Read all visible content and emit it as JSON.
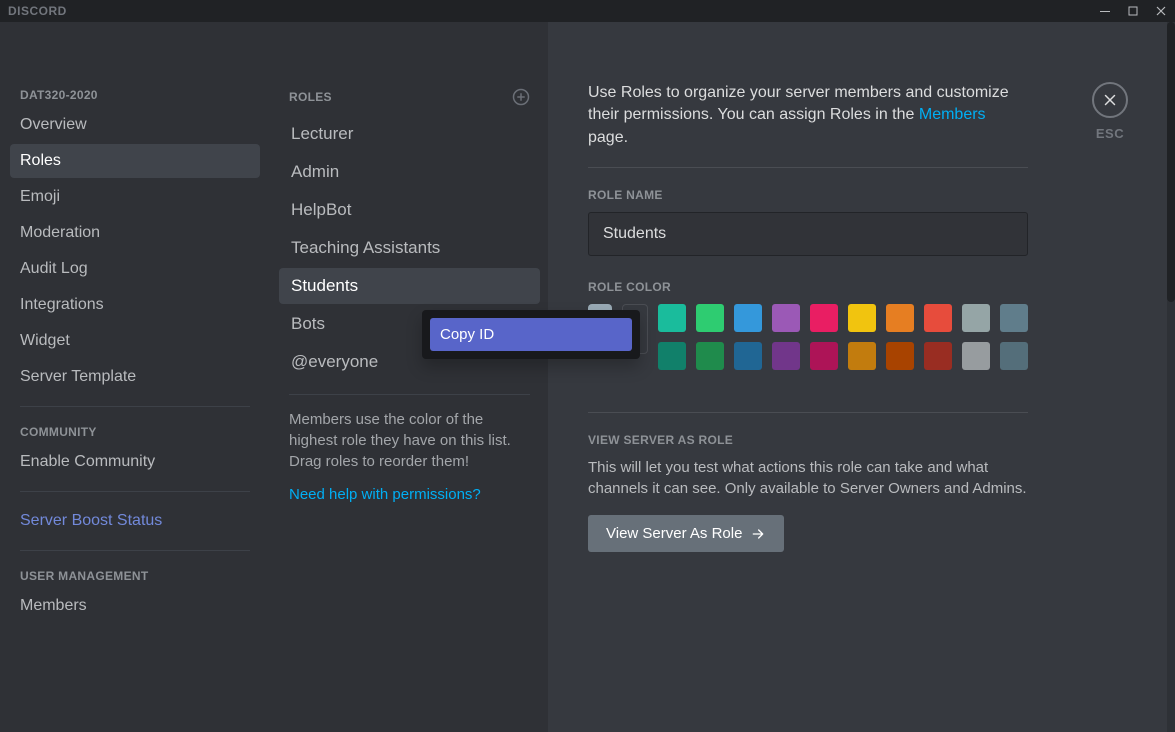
{
  "titlebar": {
    "brand": "DISCORD"
  },
  "sidebar": {
    "server_name": "DAT320-2020",
    "items": [
      {
        "label": "Overview",
        "selected": false
      },
      {
        "label": "Roles",
        "selected": true
      },
      {
        "label": "Emoji",
        "selected": false
      },
      {
        "label": "Moderation",
        "selected": false
      },
      {
        "label": "Audit Log",
        "selected": false
      },
      {
        "label": "Integrations",
        "selected": false
      },
      {
        "label": "Widget",
        "selected": false
      },
      {
        "label": "Server Template",
        "selected": false
      }
    ],
    "community_heading": "COMMUNITY",
    "community_items": [
      {
        "label": "Enable Community"
      }
    ],
    "boost_label": "Server Boost Status",
    "user_mgmt_heading": "USER MANAGEMENT",
    "user_mgmt_items": [
      {
        "label": "Members"
      }
    ]
  },
  "roles_col": {
    "heading": "ROLES",
    "items": [
      {
        "label": "Lecturer"
      },
      {
        "label": "Admin"
      },
      {
        "label": "HelpBot"
      },
      {
        "label": "Teaching Assistants"
      },
      {
        "label": "Students",
        "selected": true
      },
      {
        "label": "Bots"
      },
      {
        "label": "@everyone"
      }
    ],
    "help_text": "Members use the color of the highest role they have on this list. Drag roles to reorder them!",
    "help_link": "Need help with permissions?"
  },
  "content": {
    "intro_pre": "Use Roles to organize your server members and customize their permissions. You can assign Roles in the ",
    "intro_link": "Members",
    "intro_post": " page.",
    "role_name_label": "ROLE NAME",
    "role_name_value": "Students",
    "role_color_label": "ROLE COLOR",
    "colors_row1": [
      "#1abc9c",
      "#2ecc71",
      "#3498db",
      "#9b59b6",
      "#e91e63",
      "#f1c40f",
      "#e67e22",
      "#e74c3c",
      "#95a5a6",
      "#607d8b"
    ],
    "colors_row2": [
      "#11806a",
      "#1f8b4c",
      "#206694",
      "#71368a",
      "#ad1457",
      "#c27c0e",
      "#a84300",
      "#992d22",
      "#979c9f",
      "#546e7a"
    ],
    "view_heading": "VIEW SERVER AS ROLE",
    "view_desc": "This will let you test what actions this role can take and what channels it can see. Only available to Server Owners and Admins.",
    "view_btn": "View Server As Role"
  },
  "close": {
    "esc": "ESC"
  },
  "context_menu": {
    "items": [
      {
        "label": "Copy ID"
      }
    ]
  }
}
